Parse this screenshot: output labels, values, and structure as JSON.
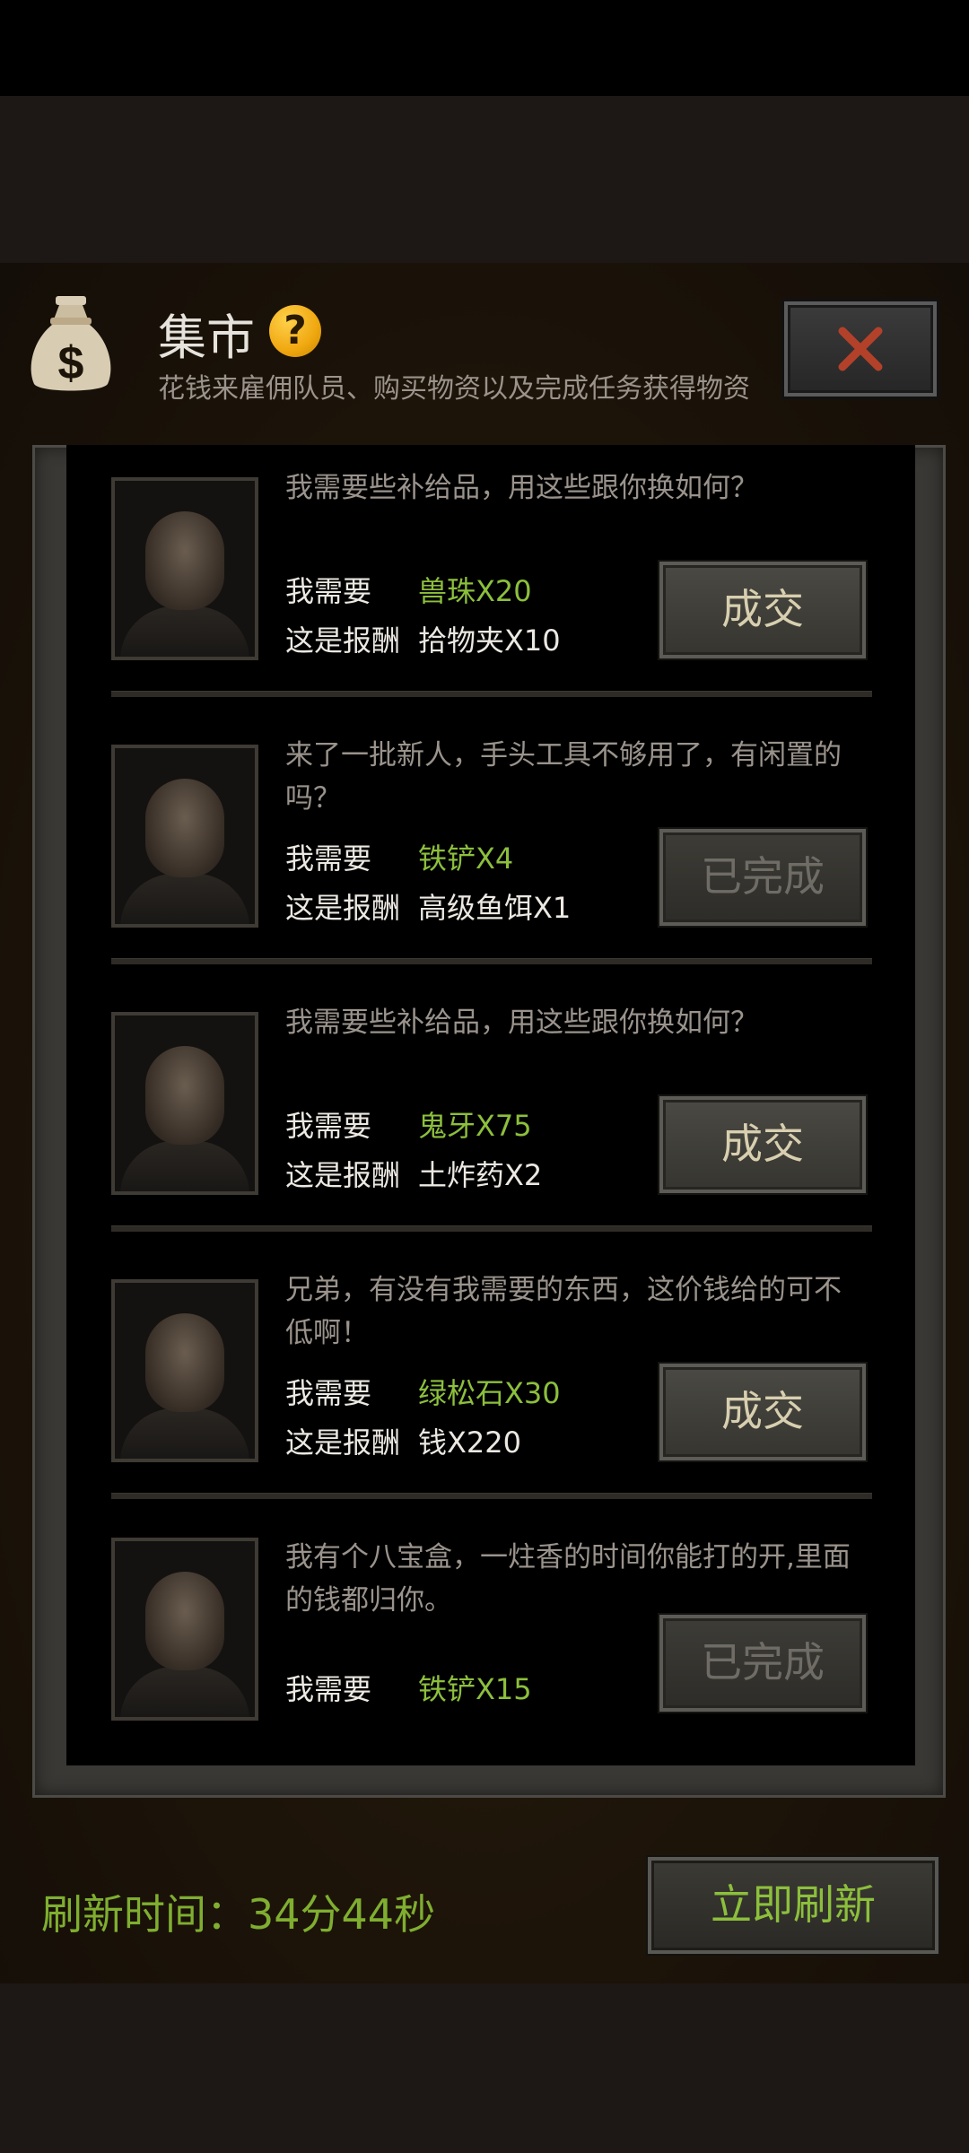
{
  "header": {
    "title": "集市",
    "help_symbol": "?",
    "subtitle": "花钱来雇佣队员、购买物资以及完成任务获得物资",
    "icon": "money-bag-icon",
    "close_icon": "close-icon"
  },
  "colors": {
    "accent_green": "#8cbf3c",
    "help_gold": "#f0a810",
    "close_red": "#b3412a"
  },
  "labels": {
    "need": "我需要",
    "reward": "这是报酬"
  },
  "quests": [
    {
      "message": "我需要些补给品，用这些跟你换如何？",
      "need": "兽珠X20",
      "reward": "拾物夹X10",
      "button": "成交",
      "status": "available"
    },
    {
      "message": "来了一批新人，手头工具不够用了，有闲置的吗？",
      "need": "铁铲X4",
      "reward": "高级鱼饵X1",
      "button": "已完成",
      "status": "done"
    },
    {
      "message": "我需要些补给品，用这些跟你换如何？",
      "need": "鬼牙X75",
      "reward": "土炸药X2",
      "button": "成交",
      "status": "available"
    },
    {
      "message": "兄弟，有没有我需要的东西，这价钱给的可不低啊！",
      "need": "绿松石X30",
      "reward": "钱X220",
      "button": "成交",
      "status": "available"
    },
    {
      "message": "我有个八宝盒，一炷香的时间你能打的开,里面的钱都归你。",
      "need": "铁铲X15",
      "reward": "",
      "button": "已完成",
      "status": "done"
    }
  ],
  "footer": {
    "refresh_time": "刷新时间：34分44秒",
    "refresh_button": "立即刷新"
  }
}
